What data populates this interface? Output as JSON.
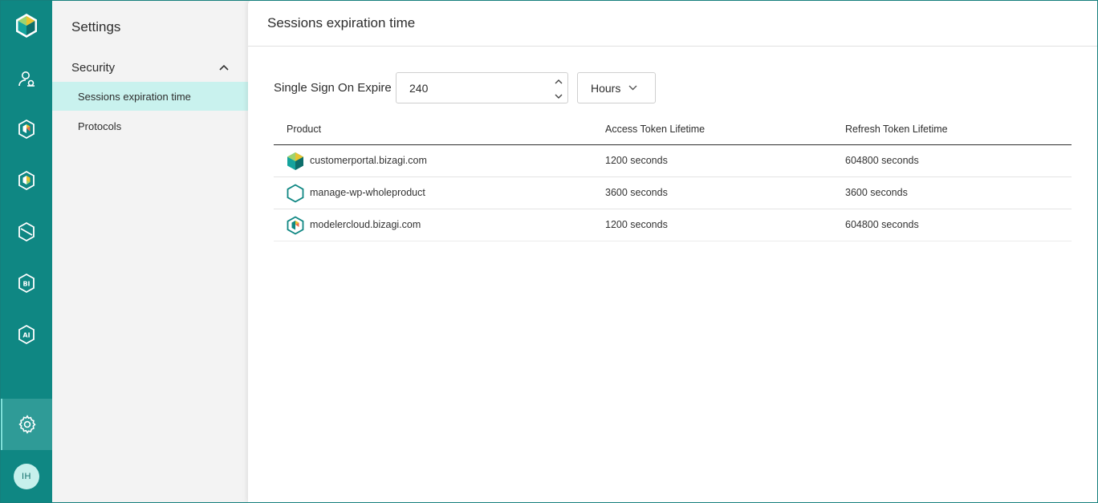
{
  "rail": {
    "items": [
      {
        "name": "bizagi-logo-icon"
      },
      {
        "name": "users-icon"
      },
      {
        "name": "product-hexagon-icon-1"
      },
      {
        "name": "product-hexagon-icon-2"
      },
      {
        "name": "product-hexagon-icon-3"
      },
      {
        "name": "bi-hexagon-icon",
        "label": "BI"
      },
      {
        "name": "ai-hexagon-icon",
        "label": "AI"
      }
    ],
    "settings_icon": "gear-icon",
    "avatar_initials": "IH"
  },
  "colors": {
    "rail": "#0f8783",
    "accent_active": "#c9f2ee",
    "logo_yellow": "#e8c330",
    "logo_green": "#9fd36e"
  },
  "settings": {
    "title": "Settings",
    "section": "Security",
    "items": [
      {
        "label": "Sessions expiration time",
        "active": true
      },
      {
        "label": "Protocols",
        "active": false
      }
    ]
  },
  "main": {
    "title": "Sessions expiration time",
    "sso": {
      "label": "Single Sign On Expire",
      "value": "240",
      "unit": "Hours"
    },
    "table": {
      "columns": [
        "Product",
        "Access Token Lifetime",
        "Refresh Token Lifetime"
      ],
      "rows": [
        {
          "product": "customerportal.bizagi.com",
          "access": "1200 seconds",
          "refresh": "604800 seconds",
          "icon": "customer-portal-icon"
        },
        {
          "product": "manage-wp-wholeproduct",
          "access": "3600 seconds",
          "refresh": "3600 seconds",
          "icon": "hexagon-outline-icon"
        },
        {
          "product": "modelercloud.bizagi.com",
          "access": "1200 seconds",
          "refresh": "604800 seconds",
          "icon": "modeler-icon"
        }
      ]
    }
  }
}
